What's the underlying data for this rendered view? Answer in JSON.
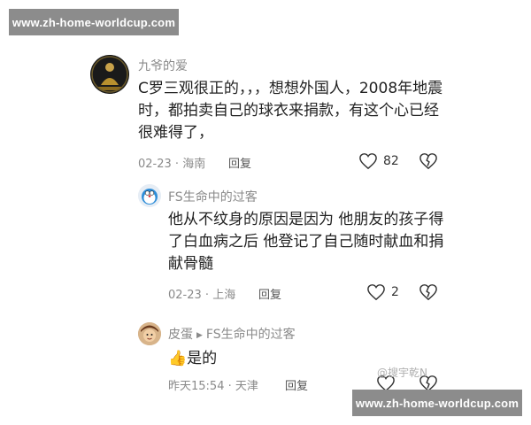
{
  "watermarks": {
    "top": "www.zh-home-worldcup.com",
    "bottom": "www.zh-home-worldcup.com",
    "inline": "@搜宇乾N"
  },
  "comments": [
    {
      "user": "九爷的爱",
      "text": "C罗三观很正的，，，想想外国人，2008年地震时，都拍卖自己的球衣来捐款，有这个心已经很难得了，",
      "date": "02-23",
      "location": "海南",
      "reply_label": "回复",
      "likes": "82",
      "avatar_icon": "golden-figure-avatar-icon"
    },
    {
      "user": "FS生命中的过客",
      "text": "他从不纹身的原因是因为 他朋友的孩子得了白血病之后 他登记了自己随时献血和捐献骨髓",
      "date": "02-23",
      "location": "上海",
      "reply_label": "回复",
      "likes": "2",
      "avatar_icon": "doraemon-avatar-icon"
    },
    {
      "user": "皮蛋",
      "reply_to": "FS生命中的过客",
      "emoji": "👍",
      "text": "是的",
      "date": "昨天15:54",
      "location": "天津",
      "reply_label": "回复",
      "avatar_icon": "cartoon-avatar-icon"
    }
  ],
  "separator": "·"
}
